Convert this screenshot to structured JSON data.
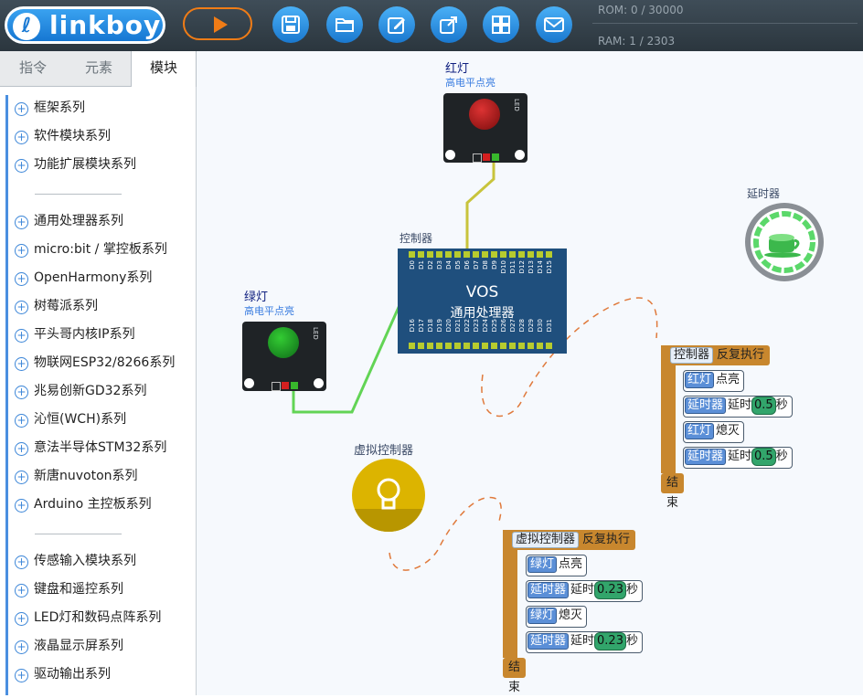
{
  "toolbar": {
    "logo_text": "linkboy",
    "rom": "ROM: 0 / 30000",
    "ram": "RAM: 1 / 2303",
    "buttons": [
      "run-button",
      "save-button",
      "open-folder-button",
      "edit-button",
      "export-button",
      "apps-button",
      "mail-button"
    ]
  },
  "panel": {
    "tabs": [
      "指令",
      "元素",
      "模块"
    ],
    "active_tab": "模块",
    "groups": [
      [
        "框架系列",
        "软件模块系列",
        "功能扩展模块系列"
      ],
      [
        "通用处理器系列",
        "micro:bit / 掌控板系列",
        "OpenHarmony系列",
        "树莓派系列",
        "平头哥内核IP系列",
        "物联网ESP32/8266系列",
        "兆易创新GD32系列",
        "沁恒(WCH)系列",
        "意法半导体STM32系列",
        "新唐nuvoton系列",
        "Arduino 主控板系列"
      ],
      [
        "传感输入模块系列",
        "键盘和遥控系列",
        "LED灯和数码点阵系列",
        "液晶显示屏系列",
        "驱动输出系列"
      ]
    ]
  },
  "canvas": {
    "red_led": {
      "name": "红灯",
      "sub": "高电平点亮",
      "side": "LED",
      "color": "#a81818"
    },
    "green_led": {
      "name": "绿灯",
      "sub": "高电平点亮",
      "side": "LED",
      "color": "#1f8f2c"
    },
    "controller": {
      "label": "控制器",
      "title": "VOS",
      "subtitle": "通用处理器",
      "top_pins": [
        "D0",
        "D1",
        "D2",
        "D3",
        "D4",
        "D5",
        "D6",
        "D7",
        "D8",
        "D9",
        "D10",
        "D11",
        "D12",
        "D13",
        "D14",
        "D15"
      ],
      "bottom_pins": [
        "D16",
        "D17",
        "D18",
        "D19",
        "D20",
        "D21",
        "D22",
        "D23",
        "D24",
        "D25",
        "D26",
        "D27",
        "D28",
        "D29",
        "D30",
        "D31"
      ]
    },
    "delay_label": "延时器",
    "virtual_label": "虚拟控制器",
    "block1": {
      "head_tag": "控制器",
      "head_text": "反复执行",
      "foot": "结束",
      "stmts": [
        {
          "tag": "红灯",
          "text": "点亮"
        },
        {
          "tag": "延时器",
          "text": "延时",
          "num": "0.5",
          "unit": "秒"
        },
        {
          "tag": "红灯",
          "text": "熄灭"
        },
        {
          "tag": "延时器",
          "text": "延时",
          "num": "0.5",
          "unit": "秒"
        }
      ]
    },
    "block2": {
      "head_tag": "虚拟控制器",
      "head_text": "反复执行",
      "foot": "结束",
      "stmts": [
        {
          "tag": "绿灯",
          "text": "点亮"
        },
        {
          "tag": "延时器",
          "text": "延时",
          "num": "0.23",
          "unit": "秒"
        },
        {
          "tag": "绿灯",
          "text": "熄灭"
        },
        {
          "tag": "延时器",
          "text": "延时",
          "num": "0.23",
          "unit": "秒"
        }
      ]
    }
  }
}
